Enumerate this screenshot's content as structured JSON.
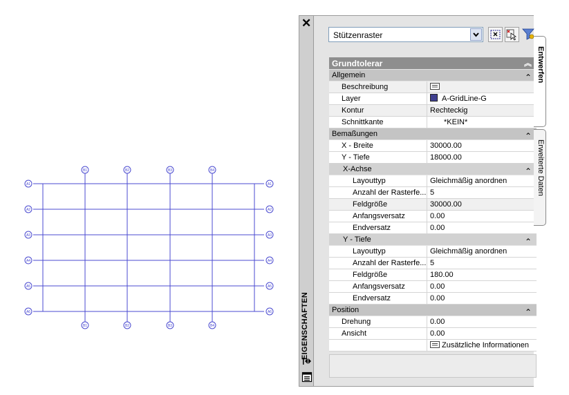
{
  "drawing": {
    "top_labels": [
      "B1",
      "B2",
      "B3",
      "B4"
    ],
    "bottom_labels": [
      "B1",
      "B2",
      "B3",
      "B4"
    ],
    "left_labels": [
      "A1",
      "A2",
      "A3",
      "A4",
      "A5",
      "A6"
    ],
    "right_labels": [
      "A1",
      "A2",
      "A3",
      "A4",
      "A5",
      "A6"
    ],
    "line_color": "#4a4ad0"
  },
  "palette": {
    "close_label": "✕",
    "side_title": "EIGENSCHAFTEN",
    "object_type": "Stützenraster",
    "tabs": {
      "design": "Entwerfen",
      "extended": "Erweiterte Daten"
    },
    "top_category": "Grundtolerar",
    "categories": {
      "general": {
        "title": "Allgemein",
        "rows": [
          {
            "label": "Beschreibung",
            "value": ""
          },
          {
            "label": "Layer",
            "value": "A-GridLine-G"
          },
          {
            "label": "Kontur",
            "value": "Rechteckig"
          },
          {
            "label": "Schnittkante",
            "value": "*KEIN*"
          }
        ]
      },
      "dimensions": {
        "title": "Bemaßungen",
        "rows": [
          {
            "label": "X - Breite",
            "value": "30000.00"
          },
          {
            "label": "Y - Tiefe",
            "value": "18000.00"
          }
        ],
        "x_axis": {
          "title": "X-Achse",
          "rows": [
            {
              "label": "Layouttyp",
              "value": "Gleichmäßig anordnen"
            },
            {
              "label": "Anzahl der Rasterfe...",
              "value": "5"
            },
            {
              "label": "Feldgröße",
              "value": "30000.00"
            },
            {
              "label": "Anfangsversatz",
              "value": "0.00"
            },
            {
              "label": "Endversatz",
              "value": "0.00"
            }
          ]
        },
        "y_axis": {
          "title": "Y - Tiefe",
          "rows": [
            {
              "label": "Layouttyp",
              "value": "Gleichmäßig anordnen"
            },
            {
              "label": "Anzahl der Rasterfe...",
              "value": "5"
            },
            {
              "label": "Feldgröße",
              "value": "180.00"
            },
            {
              "label": "Anfangsversatz",
              "value": "0.00"
            },
            {
              "label": "Endversatz",
              "value": "0.00"
            }
          ]
        }
      },
      "position": {
        "title": "Position",
        "rows": [
          {
            "label": "Drehung",
            "value": "0.00"
          },
          {
            "label": "Ansicht",
            "value": "0.00"
          },
          {
            "label": "",
            "value": "Zusätzliche Informationen"
          }
        ]
      }
    }
  }
}
